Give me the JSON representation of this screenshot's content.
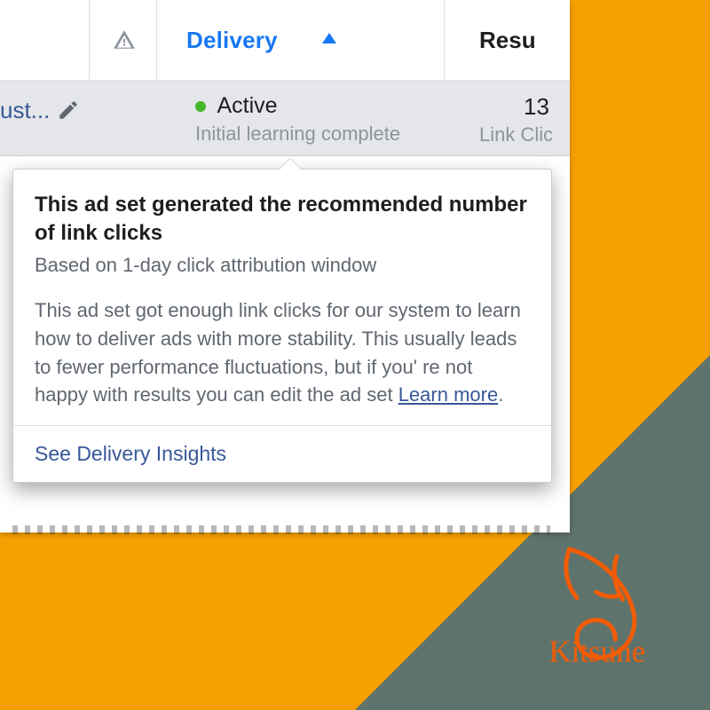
{
  "colors": {
    "accent": "#f59f00",
    "link": "#385898",
    "fb_blue": "#1877f2",
    "green": "#42b72a",
    "muted": "#8d949e",
    "tri": "#5f736d"
  },
  "table": {
    "columns": {
      "warning_icon": "warning-triangle-icon",
      "delivery": "Delivery",
      "results": "Resu"
    },
    "row": {
      "name_fragment": "ust...",
      "status": "Active",
      "status_sub": "Initial learning complete",
      "results_value": "13",
      "results_label": "Link Clic"
    }
  },
  "tooltip": {
    "heading": "This ad set generated the recommended number of link clicks",
    "subheading": "Based on 1-day click attribution window",
    "body_prefix": "This ad set got enough link clicks for our system to learn how to deliver ads with more stability. This usually leads to fewer performance fluctuations, but if you' re not happy with results you can edit the ad set ",
    "learn_more": "Learn more",
    "footer_link": "See Delivery Insights"
  },
  "brand": {
    "name": "Kitsune"
  }
}
